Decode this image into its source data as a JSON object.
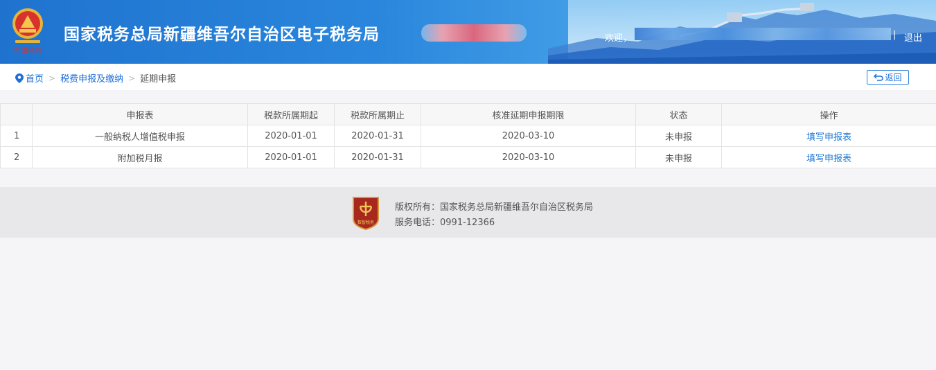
{
  "header": {
    "site_title": "国家税务总局新疆维吾尔自治区电子税务局",
    "emblem_text": "中国税务",
    "welcome": "欢迎，",
    "divider": "|",
    "logout": "退出"
  },
  "breadcrumb": {
    "home": "首页",
    "sep": ">",
    "level2": "税费申报及缴纳",
    "current": "延期申报"
  },
  "back_button": "返回",
  "table": {
    "columns": [
      "",
      "申报表",
      "税款所属期起",
      "税款所属期止",
      "核准延期申报期限",
      "状态",
      "操作"
    ],
    "rows": [
      {
        "index": "1",
        "form": "一般纳税人增值税申报",
        "start": "2020-01-01",
        "end": "2020-01-31",
        "deadline": "2020-03-10",
        "status": "未申报",
        "action": "填写申报表"
      },
      {
        "index": "2",
        "form": "附加税月报",
        "start": "2020-01-01",
        "end": "2020-01-31",
        "deadline": "2020-03-10",
        "status": "未申报",
        "action": "填写申报表"
      }
    ]
  },
  "footer": {
    "copyright": "版权所有：国家税务总局新疆维吾尔自治区税务局",
    "phone": "服务电话：0991-12366",
    "badge_text": "数智税务"
  },
  "colors": {
    "header_blue": "#2a86dc",
    "link_blue": "#1c78d4",
    "footer_bg": "#e8e8ea",
    "badge_red": "#a8281e"
  },
  "icons": [
    "location-pin-icon",
    "return-arrow-icon",
    "tax-emblem-icon",
    "footer-badge-icon"
  ]
}
